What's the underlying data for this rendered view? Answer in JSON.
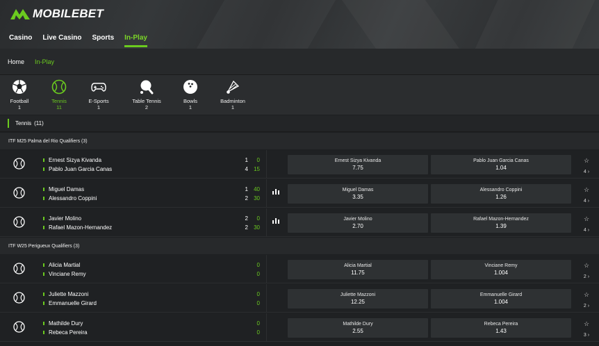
{
  "brand": {
    "name": "MOBILEBET",
    "accent": "#6bcb1f"
  },
  "nav": [
    {
      "label": "Casino"
    },
    {
      "label": "Live Casino"
    },
    {
      "label": "Sports"
    },
    {
      "label": "In-Play",
      "active": true
    }
  ],
  "breadcrumb": [
    {
      "label": "Home"
    },
    {
      "label": "In-Play",
      "active": true
    }
  ],
  "sports": [
    {
      "name": "Football",
      "count": "1",
      "icon": "football-icon"
    },
    {
      "name": "Tennis",
      "count": "11",
      "icon": "tennis-ball-icon",
      "active": true
    },
    {
      "name": "E-Sports",
      "count": "1",
      "icon": "gamepad-icon"
    },
    {
      "name": "Table Tennis",
      "count": "2",
      "icon": "table-tennis-icon"
    },
    {
      "name": "Bowls",
      "count": "1",
      "icon": "bowling-ball-icon"
    },
    {
      "name": "Badminton",
      "count": "1",
      "icon": "shuttlecock-icon"
    }
  ],
  "section": {
    "title": "Tennis",
    "count": "(11)"
  },
  "leagues": [
    {
      "name": "ITF M25 Palma del Rio Qualifiers (3)",
      "events": [
        {
          "p1": "Ernest Sizya Kivanda",
          "p2": "Pablo Juan Garcia Canas",
          "s1": "1",
          "s2": "4",
          "g1": "0",
          "g2": "15",
          "stats": false,
          "odds": [
            {
              "name": "Ernest Sizya Kivanda",
              "value": "7.75"
            },
            {
              "name": "Pablo Juan Garcia Canas",
              "value": "1.04"
            }
          ],
          "more": "4"
        },
        {
          "p1": "Miguel Damas",
          "p2": "Alessandro Coppini",
          "s1": "1",
          "s2": "2",
          "g1": "40",
          "g2": "30",
          "stats": true,
          "odds": [
            {
              "name": "Miguel Damas",
              "value": "3.35"
            },
            {
              "name": "Alessandro Coppini",
              "value": "1.26"
            }
          ],
          "more": "4"
        },
        {
          "p1": "Javier Molino",
          "p2": "Rafael Mazon-Hernandez",
          "s1": "2",
          "s2": "2",
          "g1": "0",
          "g2": "30",
          "stats": true,
          "odds": [
            {
              "name": "Javier Molino",
              "value": "2.70"
            },
            {
              "name": "Rafael Mazon-Hernandez",
              "value": "1.39"
            }
          ],
          "more": "4"
        }
      ]
    },
    {
      "name": "ITF W25 Perigueux Qualifiers (3)",
      "events": [
        {
          "p1": "Alicia Martial",
          "p2": "Vinciane Remy",
          "s1": "",
          "s2": "",
          "g1": "0",
          "g2": "0",
          "stats": false,
          "odds": [
            {
              "name": "Alicia Martial",
              "value": "11.75"
            },
            {
              "name": "Vinciane Remy",
              "value": "1.004"
            }
          ],
          "more": "2"
        },
        {
          "p1": "Juliette Mazzoni",
          "p2": "Emmanuelle Girard",
          "s1": "",
          "s2": "",
          "g1": "0",
          "g2": "0",
          "stats": false,
          "odds": [
            {
              "name": "Juliette Mazzoni",
              "value": "12.25"
            },
            {
              "name": "Emmanuelle Girard",
              "value": "1.004"
            }
          ],
          "more": "2"
        },
        {
          "p1": "Mathilde Dury",
          "p2": "Rebeca Pereira",
          "s1": "",
          "s2": "",
          "g1": "0",
          "g2": "0",
          "stats": false,
          "odds": [
            {
              "name": "Mathilde Dury",
              "value": "2.55"
            },
            {
              "name": "Rebeca Pereira",
              "value": "1.43"
            }
          ],
          "more": "3"
        }
      ]
    }
  ]
}
